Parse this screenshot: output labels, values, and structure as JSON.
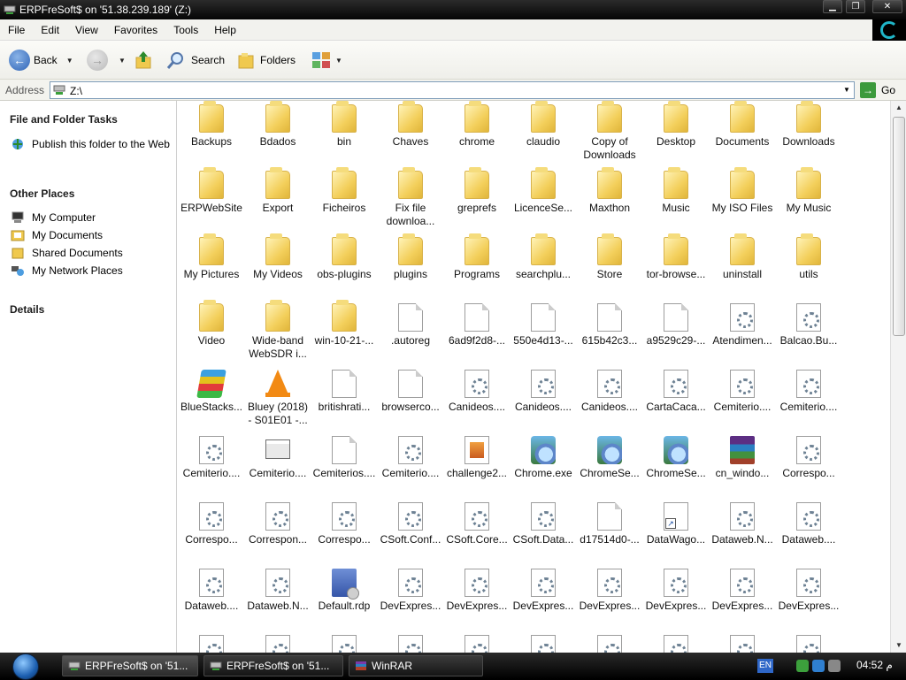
{
  "window": {
    "title": "ERPFreSoft$ on '51.38.239.189' (Z:)",
    "controls": [
      "minimize",
      "maximize",
      "close"
    ]
  },
  "menu": [
    "File",
    "Edit",
    "View",
    "Favorites",
    "Tools",
    "Help"
  ],
  "toolbar": {
    "back_label": "Back",
    "search_label": "Search",
    "folders_label": "Folders"
  },
  "address": {
    "label": "Address",
    "value": "Z:\\",
    "go_label": "Go"
  },
  "left_pane": {
    "file_tasks_title": "File and Folder Tasks",
    "file_tasks": [
      {
        "label": "Publish this folder to the Web",
        "icon": "publish-web-icon"
      }
    ],
    "other_places_title": "Other Places",
    "other_places": [
      {
        "label": "My Computer",
        "icon": "computer-icon"
      },
      {
        "label": "My Documents",
        "icon": "my-documents-icon"
      },
      {
        "label": "Shared Documents",
        "icon": "shared-documents-icon"
      },
      {
        "label": "My Network Places",
        "icon": "network-places-icon"
      }
    ],
    "details_title": "Details"
  },
  "files": [
    {
      "label": "Backups",
      "type": "folder"
    },
    {
      "label": "Bdados",
      "type": "folder"
    },
    {
      "label": "bin",
      "type": "folder"
    },
    {
      "label": "Chaves",
      "type": "folder"
    },
    {
      "label": "chrome",
      "type": "folder"
    },
    {
      "label": "claudio",
      "type": "folder"
    },
    {
      "label": "Copy of\nDownloads",
      "type": "folder"
    },
    {
      "label": "Desktop",
      "type": "folder"
    },
    {
      "label": "Documents",
      "type": "folder"
    },
    {
      "label": "Downloads",
      "type": "folder"
    },
    {
      "label": "ERPWebSite",
      "type": "folder"
    },
    {
      "label": "Export",
      "type": "folder"
    },
    {
      "label": "Ficheiros",
      "type": "folder"
    },
    {
      "label": "Fix file\ndownloa...",
      "type": "folder"
    },
    {
      "label": "greprefs",
      "type": "folder"
    },
    {
      "label": "LicenceSe...",
      "type": "folder"
    },
    {
      "label": "Maxthon",
      "type": "folder"
    },
    {
      "label": "Music",
      "type": "folder"
    },
    {
      "label": "My ISO Files",
      "type": "folder"
    },
    {
      "label": "My Music",
      "type": "folder"
    },
    {
      "label": "My Pictures",
      "type": "folder"
    },
    {
      "label": "My Videos",
      "type": "folder"
    },
    {
      "label": "obs-plugins",
      "type": "folder"
    },
    {
      "label": "plugins",
      "type": "folder"
    },
    {
      "label": "Programs",
      "type": "folder"
    },
    {
      "label": "searchplu...",
      "type": "folder"
    },
    {
      "label": "Store",
      "type": "folder"
    },
    {
      "label": "tor-browse...",
      "type": "folder"
    },
    {
      "label": "uninstall",
      "type": "folder"
    },
    {
      "label": "utils",
      "type": "folder"
    },
    {
      "label": "Video",
      "type": "folder"
    },
    {
      "label": "Wide-band\nWebSDR i...",
      "type": "folder"
    },
    {
      "label": "win-10-21-...",
      "type": "folder"
    },
    {
      "label": ".autoreg",
      "type": "doc"
    },
    {
      "label": "6ad9f2d8-...",
      "type": "doc"
    },
    {
      "label": "550e4d13-...",
      "type": "doc"
    },
    {
      "label": "615b42c3...",
      "type": "doc"
    },
    {
      "label": "a9529c29-...",
      "type": "doc"
    },
    {
      "label": "Atendimen...",
      "type": "gear"
    },
    {
      "label": "Balcao.Bu...",
      "type": "gear"
    },
    {
      "label": "BlueStacks...",
      "type": "bluestacks"
    },
    {
      "label": "Bluey (2018)\n- S01E01 -...",
      "type": "vlc"
    },
    {
      "label": "britishrati...",
      "type": "doc"
    },
    {
      "label": "browserco...",
      "type": "doc"
    },
    {
      "label": "Canideos....",
      "type": "gear"
    },
    {
      "label": "Canideos....",
      "type": "gear"
    },
    {
      "label": "Canideos....",
      "type": "gear"
    },
    {
      "label": "CartaCaca...",
      "type": "gear"
    },
    {
      "label": "Cemiterio....",
      "type": "gear"
    },
    {
      "label": "Cemiterio....",
      "type": "gear"
    },
    {
      "label": "Cemiterio....",
      "type": "gear"
    },
    {
      "label": "Cemiterio....",
      "type": "window"
    },
    {
      "label": "Cemiterios....",
      "type": "doc"
    },
    {
      "label": "Cemiterio....",
      "type": "gear"
    },
    {
      "label": "challenge2...",
      "type": "challenge"
    },
    {
      "label": "Chrome.exe",
      "type": "chromeexe"
    },
    {
      "label": "ChromeSe...",
      "type": "chromeexe"
    },
    {
      "label": "ChromeSe...",
      "type": "chromeexe"
    },
    {
      "label": "cn_windo...",
      "type": "winrar"
    },
    {
      "label": "Correspo...",
      "type": "gear"
    },
    {
      "label": "Correspo...",
      "type": "gear"
    },
    {
      "label": "Correspon...",
      "type": "gear"
    },
    {
      "label": "Correspo...",
      "type": "gear"
    },
    {
      "label": "CSoft.Conf...",
      "type": "gear"
    },
    {
      "label": "CSoft.Core...",
      "type": "gear"
    },
    {
      "label": "CSoft.Data...",
      "type": "gear"
    },
    {
      "label": "d17514d0-...",
      "type": "doc"
    },
    {
      "label": "DataWago...",
      "type": "shortcutdoc"
    },
    {
      "label": "Dataweb.N...",
      "type": "gear"
    },
    {
      "label": "Dataweb....",
      "type": "gear"
    },
    {
      "label": "Dataweb....",
      "type": "gear"
    },
    {
      "label": "Dataweb.N...",
      "type": "gear"
    },
    {
      "label": "Default.rdp",
      "type": "rdp"
    },
    {
      "label": "DevExpres...",
      "type": "gear"
    },
    {
      "label": "DevExpres...",
      "type": "gear"
    },
    {
      "label": "DevExpres...",
      "type": "gear"
    },
    {
      "label": "DevExpres...",
      "type": "gear"
    },
    {
      "label": "DevExpres...",
      "type": "gear"
    },
    {
      "label": "DevExpres...",
      "type": "gear"
    },
    {
      "label": "DevExpres...",
      "type": "gear"
    },
    {
      "label": "",
      "type": "gear"
    },
    {
      "label": "",
      "type": "gear"
    },
    {
      "label": "",
      "type": "gear"
    },
    {
      "label": "",
      "type": "gear"
    },
    {
      "label": "",
      "type": "gear"
    },
    {
      "label": "",
      "type": "gear"
    },
    {
      "label": "",
      "type": "gear"
    },
    {
      "label": "",
      "type": "gear"
    },
    {
      "label": "",
      "type": "gear"
    },
    {
      "label": "",
      "type": "gear"
    }
  ],
  "taskbar": {
    "buttons": [
      {
        "label": "ERPFreSoft$ on '51...",
        "active": true
      },
      {
        "label": "ERPFreSoft$ on '51...",
        "active": false
      },
      {
        "label": "WinRAR",
        "active": false
      }
    ],
    "language": "EN",
    "clock": "04:52 م"
  }
}
